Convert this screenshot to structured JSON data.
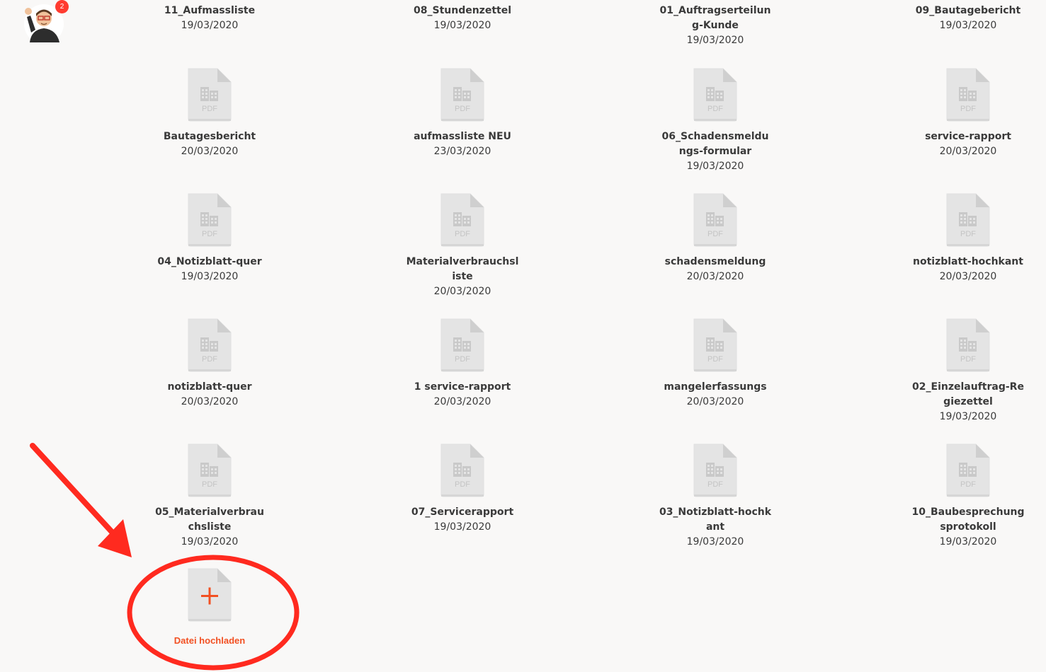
{
  "avatar": {
    "badge_count": "2"
  },
  "pdf_label": "PDF",
  "files": [
    {
      "name": "11_Aufmassliste",
      "date": "19/03/2020"
    },
    {
      "name": "08_Stundenzettel",
      "date": "19/03/2020"
    },
    {
      "name": "01_Auftragserteilung-Kunde",
      "date": "19/03/2020"
    },
    {
      "name": "09_Bautagebericht",
      "date": "19/03/2020"
    },
    {
      "name": "Bautagesbericht",
      "date": "20/03/2020"
    },
    {
      "name": "aufmassliste NEU",
      "date": "23/03/2020"
    },
    {
      "name": "06_Schadensmeldungs-formular",
      "date": "19/03/2020"
    },
    {
      "name": "service-rapport",
      "date": "20/03/2020"
    },
    {
      "name": "04_Notizblatt-quer",
      "date": "19/03/2020"
    },
    {
      "name": "Materialverbrauchsliste",
      "date": "20/03/2020"
    },
    {
      "name": "schadensmeldung",
      "date": "20/03/2020"
    },
    {
      "name": "notizblatt-hochkant",
      "date": "20/03/2020"
    },
    {
      "name": "notizblatt-quer",
      "date": "20/03/2020"
    },
    {
      "name": "1 service-rapport",
      "date": "20/03/2020"
    },
    {
      "name": "mangelerfassungs",
      "date": "20/03/2020"
    },
    {
      "name": "02_Einzelauftrag-Regiezettel",
      "date": "19/03/2020"
    },
    {
      "name": "05_Materialverbrauchsliste",
      "date": "19/03/2020"
    },
    {
      "name": "07_Servicerapport",
      "date": "19/03/2020"
    },
    {
      "name": "03_Notizblatt-hochkant",
      "date": "19/03/2020"
    },
    {
      "name": "10_Baubesprechungsprotokoll",
      "date": "19/03/2020"
    }
  ],
  "upload": {
    "label": "Datei hochladen",
    "icon": "plus-icon"
  },
  "colors": {
    "accent": "#f25022",
    "annotation": "#ff2a1f",
    "badge": "#ff3b30",
    "background": "#f9f8f7",
    "file_icon": "#e4e4e4"
  }
}
